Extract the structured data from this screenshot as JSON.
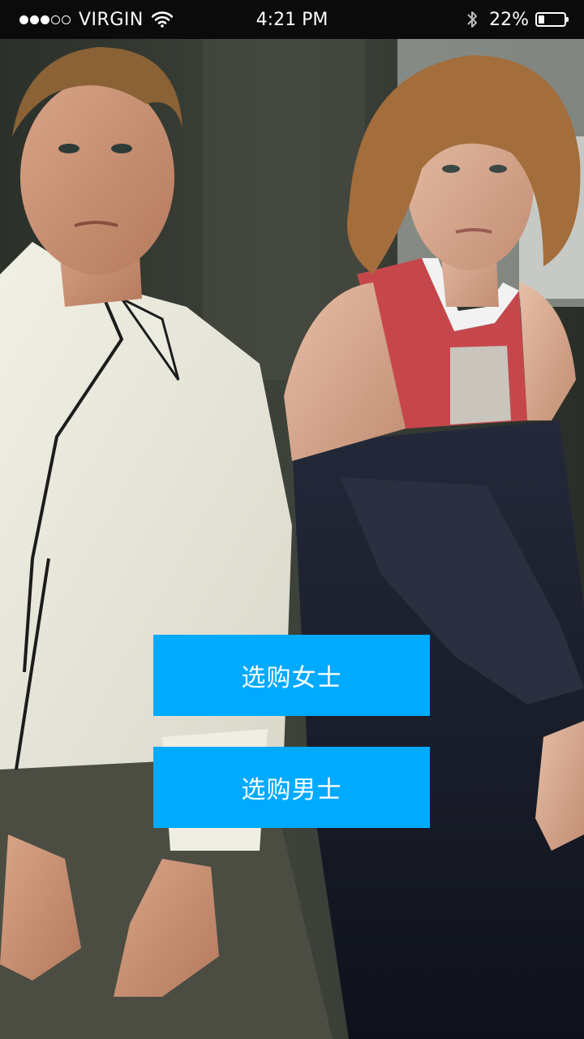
{
  "status_bar": {
    "signal_bars_filled": 3,
    "signal_bars_total": 5,
    "carrier": "VIRGIN",
    "time": "4:21 PM",
    "battery_percent_text": "22%",
    "battery_level": 0.22,
    "icons": [
      "signal-dots-icon",
      "wifi-icon",
      "bluetooth-icon",
      "battery-icon"
    ]
  },
  "hero": {
    "image": "fashion-photo-man-and-woman"
  },
  "actions": {
    "shop_women_label": "选购女士",
    "shop_men_label": "选购男士"
  },
  "colors": {
    "button_bg": "#00aaff",
    "button_text": "#ffffff",
    "status_bar_bg": "#0b0b0b"
  }
}
